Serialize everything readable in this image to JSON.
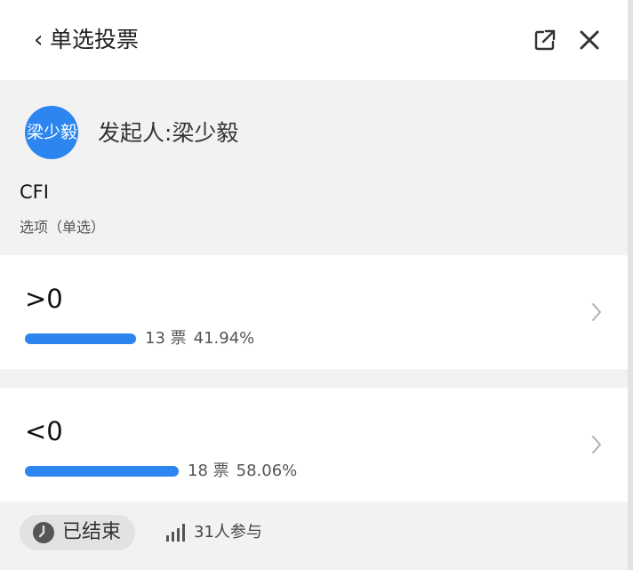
{
  "header": {
    "back_glyph": "‹",
    "title": "单选投票",
    "open_external_icon": "open-external-icon",
    "close_icon": "close-icon"
  },
  "poll": {
    "avatar_text": "梁少毅",
    "initiator": "发起人:梁少毅",
    "question": "CFI",
    "type_label": "选项（单选）"
  },
  "options": [
    {
      "label": ">0",
      "votes": "13 票",
      "percent": "41.94%",
      "share": 0.4194
    },
    {
      "label": "<0",
      "votes": "18 票",
      "percent": "58.06%",
      "share": 0.5806
    }
  ],
  "footer": {
    "status": "已结束",
    "participants": "31人参与"
  },
  "colors": {
    "accent": "#2d85f0",
    "page_bg": "#f2f2f2",
    "card_bg": "#ffffff",
    "badge_bg": "#e2e2e2"
  }
}
